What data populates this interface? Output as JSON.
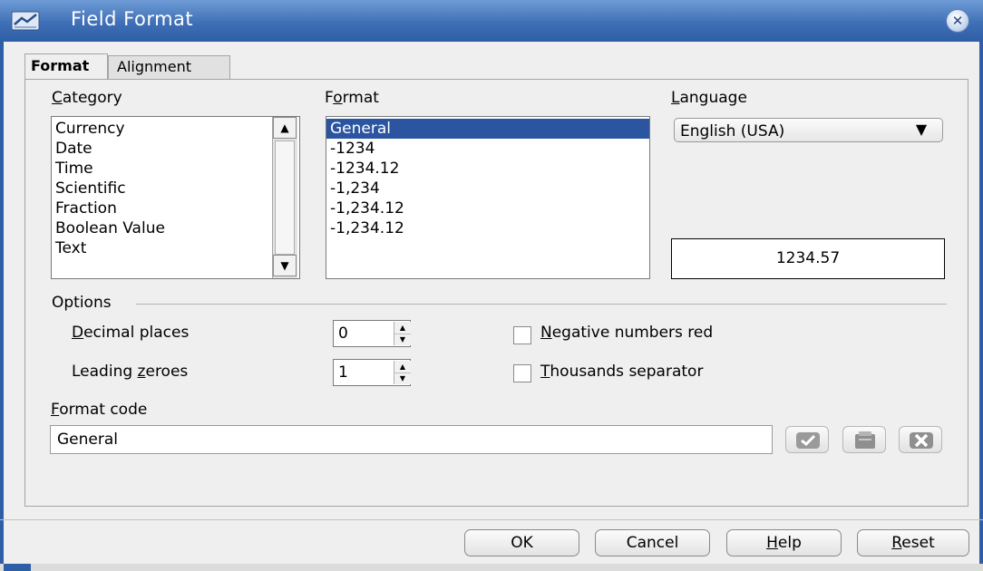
{
  "window": {
    "title": "Field Format",
    "title_icon": "calc-app-icon",
    "close_icon": "close-icon"
  },
  "tabs": [
    {
      "label": "Format",
      "active": true
    },
    {
      "label": "Alignment",
      "active": false
    }
  ],
  "category": {
    "label_first": "C",
    "label_rest": "ategory",
    "items": [
      "Currency",
      "Date",
      "Time",
      "Scientific",
      "Fraction",
      "Boolean Value",
      "Text"
    ]
  },
  "format": {
    "label_first": "F",
    "label_underlined": "o",
    "label_rest": "rmat",
    "items": [
      "General",
      "-1234",
      "-1234.12",
      "-1,234",
      "-1,234.12",
      "-1,234.12"
    ],
    "selected_index": 0
  },
  "language": {
    "label_first": "L",
    "label_rest": "anguage",
    "selected": "English (USA)"
  },
  "preview": "1234.57",
  "options": {
    "section_label": "Options",
    "decimal_places": {
      "label_first": "D",
      "label_rest": "ecimal places",
      "value": "0"
    },
    "leading_zeroes": {
      "label_pre": "Leading ",
      "label_underlined": "z",
      "label_rest": "eroes",
      "value": "1"
    },
    "negative_red": {
      "label_first": "N",
      "label_rest": "egative numbers red",
      "checked": false
    },
    "thousands_sep": {
      "label_first": "T",
      "label_rest": "housands separator",
      "checked": false
    }
  },
  "format_code": {
    "label_first": "F",
    "label_rest": "ormat code",
    "value": "General",
    "icons": [
      "checkmark-icon",
      "comment-icon",
      "delete-x-icon"
    ]
  },
  "buttons": {
    "ok": "OK",
    "cancel": "Cancel",
    "help_first": "H",
    "help_rest": "elp",
    "reset_first": "R",
    "reset_rest": "eset"
  }
}
